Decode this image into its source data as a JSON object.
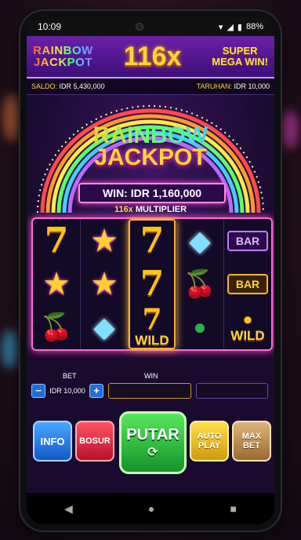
{
  "status": {
    "time": "10:09",
    "battery": "88%"
  },
  "banner": {
    "jackpot_line1": "RAINBOW",
    "jackpot_line2": "JACKPOT",
    "multiplier": "116x",
    "mega_line1": "SUPER",
    "mega_line2": "MEGA WIN!"
  },
  "info": {
    "saldo_label": "SALDO:",
    "saldo_value": "IDR 5,430,000",
    "taruhan_label": "TARUHAN:",
    "taruhan_value": "IDR 10,000"
  },
  "arena": {
    "title_line1": "RAINBOW",
    "title_line2": "JACKPOT",
    "win_text": "WIN: IDR 1,160,000",
    "multiplier_value": "116x",
    "multiplier_label": "MULTIPLIER"
  },
  "reels": [
    {
      "hot": false,
      "symbols": [
        {
          "kind": "seven",
          "glyph": "7"
        },
        {
          "kind": "star",
          "glyph": "★"
        },
        {
          "kind": "cherry",
          "glyph": "🍒"
        }
      ]
    },
    {
      "hot": false,
      "symbols": [
        {
          "kind": "star",
          "glyph": "★"
        },
        {
          "kind": "star",
          "glyph": "★"
        },
        {
          "kind": "diamond",
          "glyph": "◆"
        }
      ]
    },
    {
      "hot": true,
      "symbols": [
        {
          "kind": "seven",
          "glyph": "7"
        },
        {
          "kind": "seven",
          "glyph": "7"
        },
        {
          "kind": "wild",
          "glyph": "7",
          "label": "WILD"
        }
      ]
    },
    {
      "hot": false,
      "symbols": [
        {
          "kind": "diamond",
          "glyph": "◆"
        },
        {
          "kind": "cherry",
          "glyph": "🍒"
        },
        {
          "kind": "pot",
          "glyph": "●"
        }
      ]
    },
    {
      "hot": false,
      "symbols": [
        {
          "kind": "bar-purple",
          "label": "BAR"
        },
        {
          "kind": "bar-gold",
          "label": "BAR"
        },
        {
          "kind": "wild",
          "label": "WILD"
        }
      ]
    }
  ],
  "controls": {
    "bet_label": "BET",
    "win_label": "WIN",
    "bet_value": "IDR 10,000",
    "minus": "−",
    "plus": "+"
  },
  "buttons": {
    "info": "INFO",
    "bonus": "BOSUR",
    "spin": "PUTAR",
    "auto_line1": "AUTO",
    "auto_line2": "PLAY",
    "max_line1": "MAX",
    "max_line2": "BET"
  },
  "colors": {
    "accent_pink": "#ff4fd8",
    "gold": "#ffd43b",
    "spin_green": "#14932a"
  }
}
